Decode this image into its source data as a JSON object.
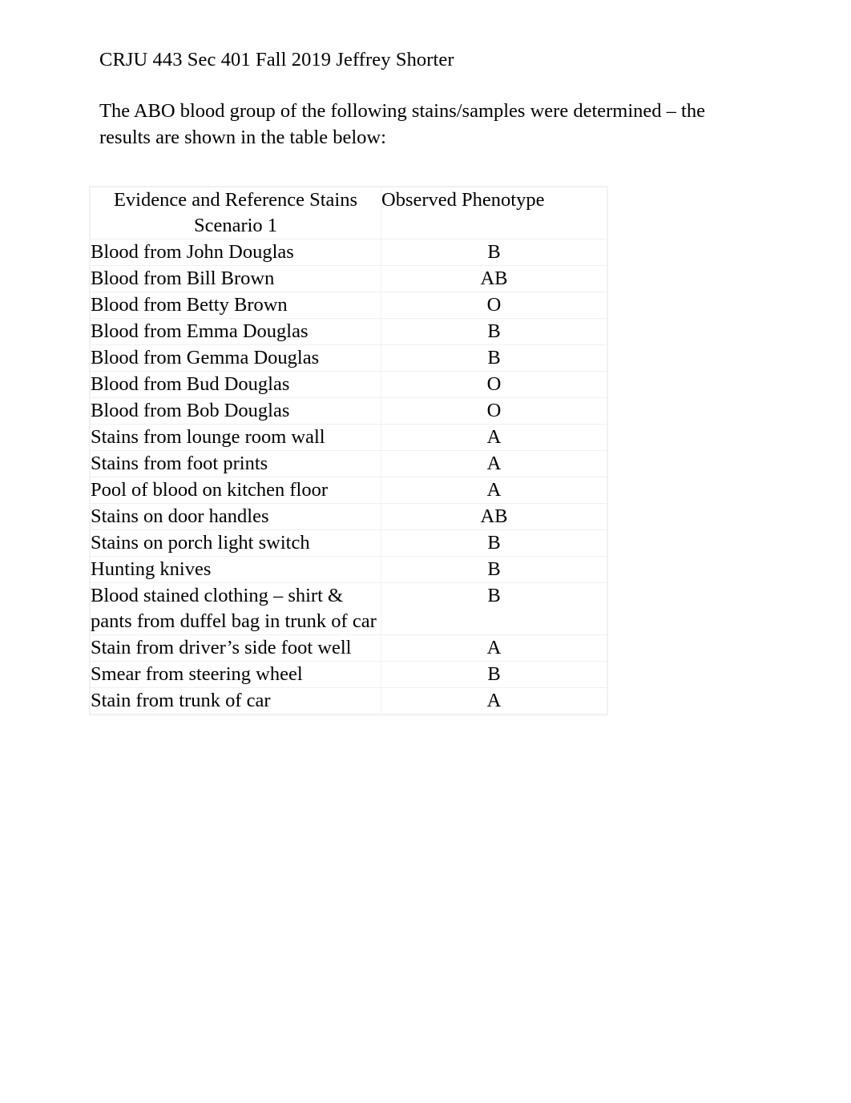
{
  "document": {
    "course_header": "CRJU 443 Sec 401 Fall 2019 Jeffrey Shorter",
    "intro_paragraph": "The ABO blood group of the following stains/samples were determined – the results are shown in the table below:"
  },
  "table": {
    "headers": {
      "evidence": "Evidence and Reference Stains Scenario 1",
      "evidence_line1": "Evidence and Reference Stains",
      "evidence_line2": "Scenario 1",
      "phenotype": "Observed Phenotype"
    },
    "rows": [
      {
        "evidence": "Blood from John Douglas",
        "phenotype": "B"
      },
      {
        "evidence": "Blood from Bill Brown",
        "phenotype": "AB"
      },
      {
        "evidence": "Blood from Betty Brown",
        "phenotype": "O"
      },
      {
        "evidence": "Blood from Emma Douglas",
        "phenotype": "B"
      },
      {
        "evidence": "Blood from Gemma Douglas",
        "phenotype": "B"
      },
      {
        "evidence": "Blood from Bud Douglas",
        "phenotype": "O"
      },
      {
        "evidence": "Blood from Bob Douglas",
        "phenotype": "O"
      },
      {
        "evidence": "Stains from lounge room wall",
        "phenotype": "A"
      },
      {
        "evidence": "Stains from foot prints",
        "phenotype": "A"
      },
      {
        "evidence": "Pool of blood on kitchen floor",
        "phenotype": "A"
      },
      {
        "evidence": "Stains on door handles",
        "phenotype": "AB"
      },
      {
        "evidence": "Stains on porch light switch",
        "phenotype": "B"
      },
      {
        "evidence": "Hunting knives",
        "phenotype": "B"
      },
      {
        "evidence": "Blood stained clothing – shirt & pants from duffel bag in trunk of car",
        "phenotype": "B"
      },
      {
        "evidence": "Stain from driver’s side foot well",
        "phenotype": "A"
      },
      {
        "evidence": "Smear from steering wheel",
        "phenotype": "B"
      },
      {
        "evidence": "Stain from trunk of car",
        "phenotype": "A"
      }
    ]
  }
}
